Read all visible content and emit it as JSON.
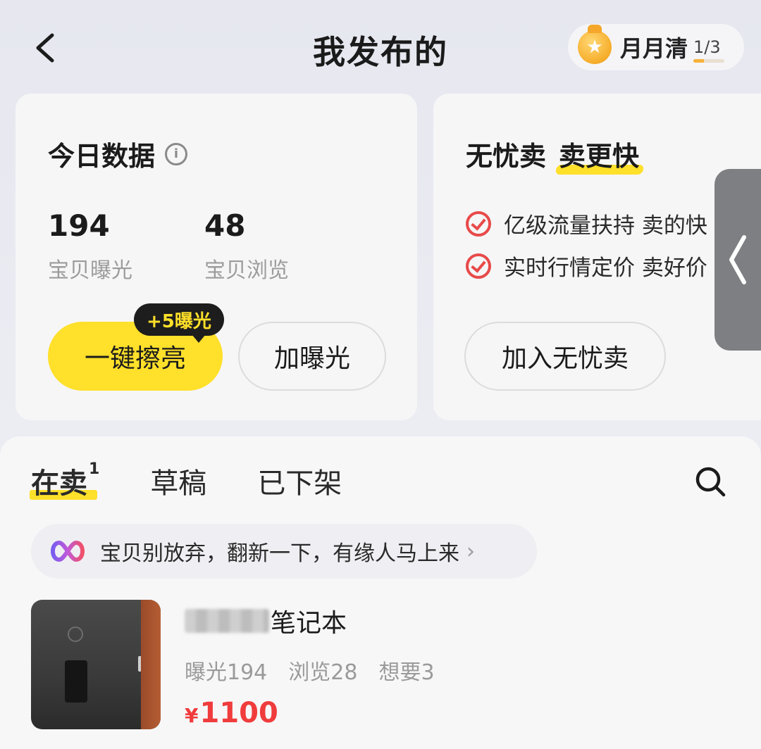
{
  "header": {
    "title": "我发布的",
    "badge_label": "月月清",
    "badge_progress": "1/3",
    "badge_progress_value": 0.33
  },
  "today_card": {
    "title": "今日数据",
    "stats": [
      {
        "value": "194",
        "label": "宝贝曝光"
      },
      {
        "value": "48",
        "label": "宝贝浏览"
      }
    ],
    "bubble": "+5曝光",
    "polish_button": "一键擦亮",
    "exposure_button": "加曝光"
  },
  "promo_card": {
    "title_part1": "无忧卖",
    "title_part2": "卖更快",
    "features": [
      "亿级流量扶持 卖的快",
      "实时行情定价 卖好价"
    ],
    "join_button": "加入无忧卖"
  },
  "tabs": [
    {
      "label": "在卖",
      "count": "1",
      "active": true
    },
    {
      "label": "草稿"
    },
    {
      "label": "已下架"
    }
  ],
  "tip": {
    "text": "宝贝别放弃，翻新一下，有缘人马上来",
    "chevron": "›"
  },
  "item": {
    "title_suffix": "笔记本",
    "stats": [
      "曝光194",
      "浏览28",
      "想要3"
    ],
    "currency": "¥",
    "price": "1100"
  },
  "colors": {
    "accent_yellow": "#ffe02a",
    "price_red": "#f03c3c",
    "check_red": "#e84a4a"
  }
}
